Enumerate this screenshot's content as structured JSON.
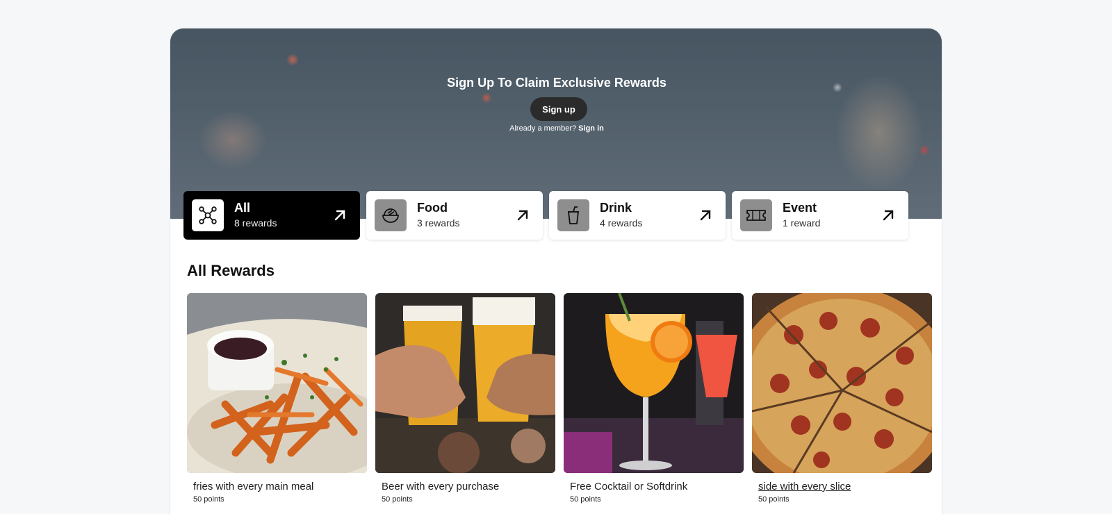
{
  "hero": {
    "title": "Sign Up To Claim Exclusive Rewards",
    "signup_label": "Sign up",
    "member_prompt": "Already a member?",
    "signin_label": "Sign in"
  },
  "categories": [
    {
      "name": "All",
      "count": "8 rewards",
      "icon": "network-icon",
      "active": true
    },
    {
      "name": "Food",
      "count": "3 rewards",
      "icon": "bowl-icon",
      "active": false
    },
    {
      "name": "Drink",
      "count": "4 rewards",
      "icon": "cup-icon",
      "active": false
    },
    {
      "name": "Event",
      "count": "1 reward",
      "icon": "ticket-icon",
      "active": false
    }
  ],
  "section_title": "All Rewards",
  "rewards": [
    {
      "name": "fries with every main meal",
      "points": "50 points",
      "image": "fries-photo"
    },
    {
      "name": "Beer with every purchase",
      "points": "50 points",
      "image": "beer-photo"
    },
    {
      "name": "Free Cocktail or Softdrink",
      "points": "50 points",
      "image": "cocktail-photo"
    },
    {
      "name": "side with every slice",
      "points": "50 points",
      "image": "pizza-photo"
    }
  ],
  "colors": {
    "page_bg": "#f6f7f9",
    "active_category": "#000000",
    "icon_tile": "#8e8e8e",
    "signup_button": "#2b2b2b"
  }
}
